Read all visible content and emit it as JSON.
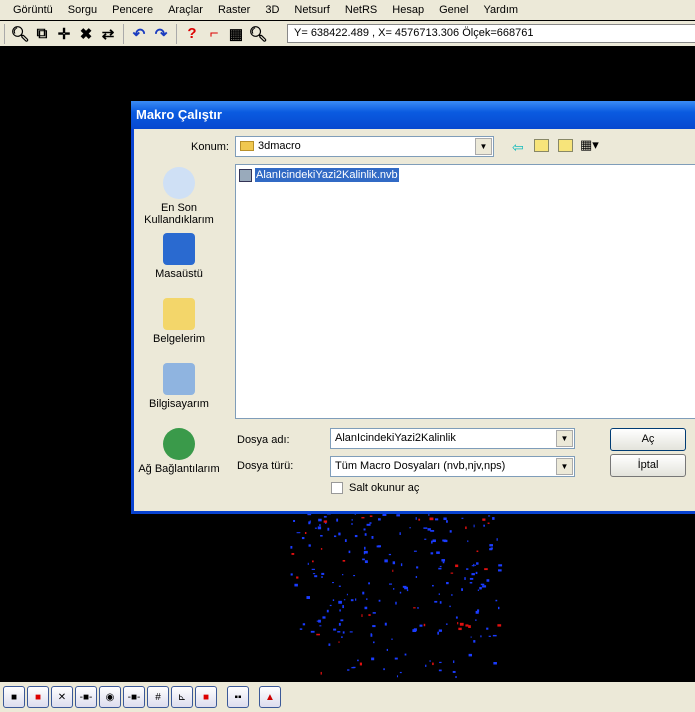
{
  "menu": [
    "Görüntü",
    "Sorgu",
    "Pencere",
    "Araçlar",
    "Raster",
    "3D",
    "Netsurf",
    "NetRS",
    "Hesap",
    "Genel",
    "Yardım"
  ],
  "status": {
    "coords": "Y= 638422.489 , X= 4576713.306 Ölçek=668761"
  },
  "dialog": {
    "title": "Makro Çalıştır",
    "location_label": "Konum:",
    "location_value": "3dmacro",
    "places": [
      "En Son Kullandıklarım",
      "Masaüstü",
      "Belgelerim",
      "Bilgisayarım",
      "Ağ Bağlantılarım"
    ],
    "files": [
      "AlanIcindekiYazi2Kalinlik.nvb"
    ],
    "filename_label": "Dosya adı:",
    "filename_value": "AlanIcindekiYazi2Kalinlik",
    "filetype_label": "Dosya türü:",
    "filetype_value": "Tüm Macro Dosyaları (nvb,njv,nps)",
    "readonly_label": "Salt okunur aç",
    "readonly_checked": false,
    "open_label": "Aç",
    "cancel_label": "İptal"
  },
  "colors": {
    "title": "#0a5be0",
    "selection": "#316ac5",
    "points_blue": "#1a3cff",
    "points_red": "#e01010"
  }
}
